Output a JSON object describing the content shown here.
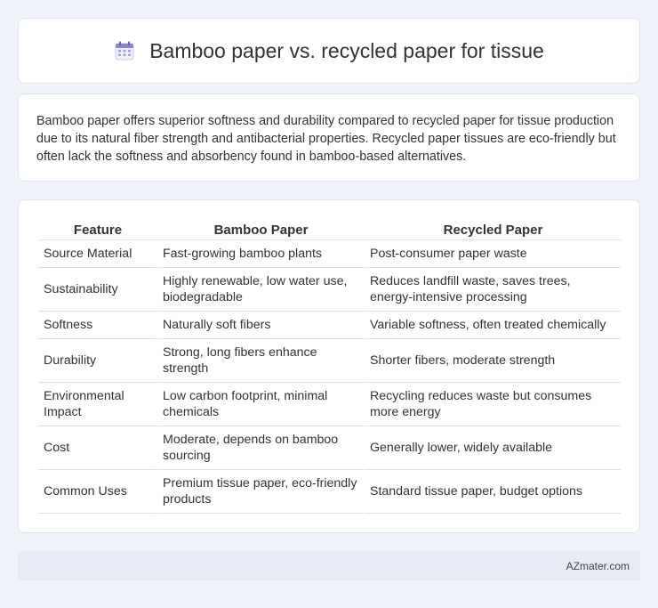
{
  "header": {
    "title": "Bamboo paper vs. recycled paper for tissue",
    "icon": "calendar-icon"
  },
  "summary": {
    "text": "Bamboo paper offers superior softness and durability compared to recycled paper for tissue production due to its natural fiber strength and antibacterial properties. Recycled paper tissues are eco-friendly but often lack the softness and absorbency found in bamboo-based alternatives."
  },
  "table": {
    "headers": [
      "Feature",
      "Bamboo Paper",
      "Recycled Paper"
    ],
    "rows": [
      [
        "Source Material",
        "Fast-growing bamboo plants",
        "Post-consumer paper waste"
      ],
      [
        "Sustainability",
        "Highly renewable, low water use, biodegradable",
        "Reduces landfill waste, saves trees, energy-intensive processing"
      ],
      [
        "Softness",
        "Naturally soft fibers",
        "Variable softness, often treated chemically"
      ],
      [
        "Durability",
        "Strong, long fibers enhance strength",
        "Shorter fibers, moderate strength"
      ],
      [
        "Environmental Impact",
        "Low carbon footprint, minimal chemicals",
        "Recycling reduces waste but consumes more energy"
      ],
      [
        "Cost",
        "Moderate, depends on bamboo sourcing",
        "Generally lower, widely available"
      ],
      [
        "Common Uses",
        "Premium tissue paper, eco-friendly products",
        "Standard tissue paper, budget options"
      ]
    ]
  },
  "footer": {
    "brand": "AZmater.com"
  },
  "colors": {
    "background": "#f0f3f9",
    "card": "#ffffff",
    "footer_bg": "#e6ebf5",
    "icon_accent": "#8a7fd6"
  }
}
